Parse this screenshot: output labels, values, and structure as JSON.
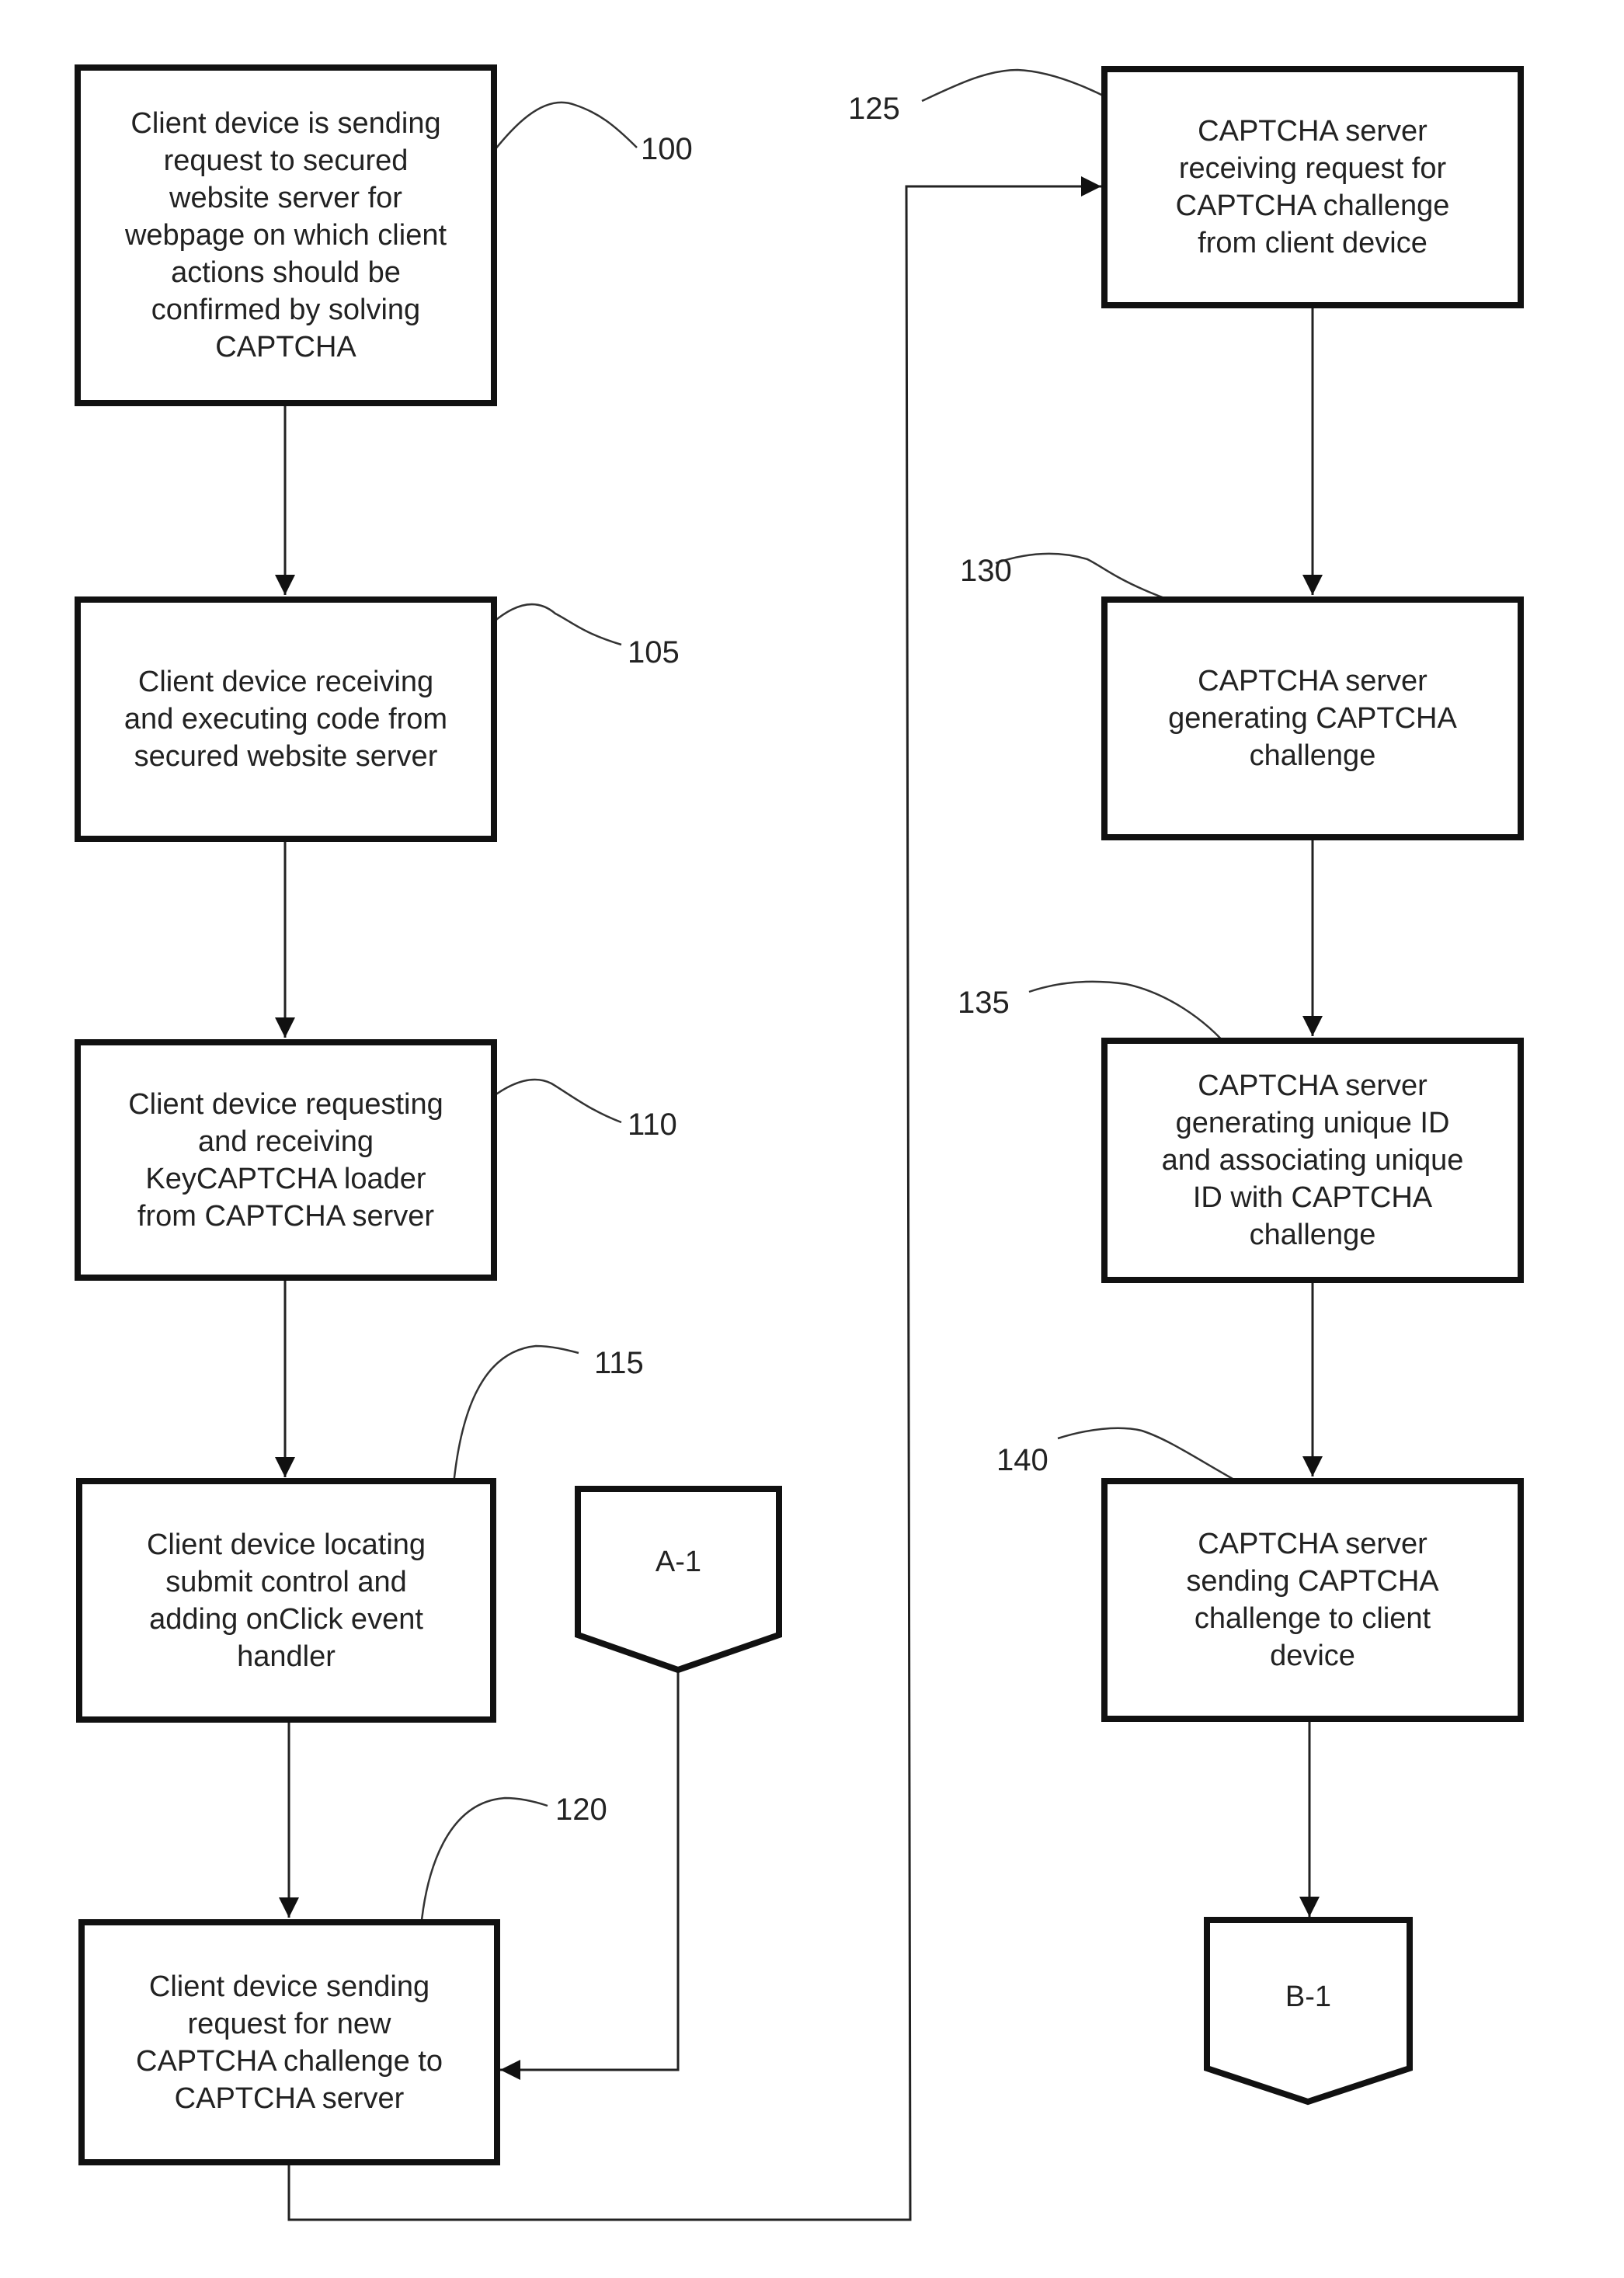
{
  "figure": {
    "type": "flowchart",
    "steps": [
      {
        "id": "100",
        "ref": "100",
        "text": "Client device is sending\nrequest to secured\nwebsite server for\nwebpage on which client\nactions should be\nconfirmed by solving\nCAPTCHA"
      },
      {
        "id": "105",
        "ref": "105",
        "text": "Client device receiving\nand executing code from\nsecured website server"
      },
      {
        "id": "110",
        "ref": "110",
        "text": "Client device requesting\nand receiving\nKeyCAPTCHA loader\nfrom CAPTCHA server"
      },
      {
        "id": "115",
        "ref": "115",
        "text": "Client device locating\nsubmit control and\nadding onClick event\nhandler"
      },
      {
        "id": "120",
        "ref": "120",
        "text": "Client device sending\nrequest for new\nCAPTCHA challenge to\nCAPTCHA server"
      },
      {
        "id": "125",
        "ref": "125",
        "text": "CAPTCHA server\nreceiving request for\nCAPTCHA challenge\nfrom client device"
      },
      {
        "id": "130",
        "ref": "130",
        "text": "CAPTCHA server\ngenerating CAPTCHA\nchallenge"
      },
      {
        "id": "135",
        "ref": "135",
        "text": "CAPTCHA server\ngenerating unique ID\nand associating unique\nID with CAPTCHA\nchallenge"
      },
      {
        "id": "140",
        "ref": "140",
        "text": "CAPTCHA server\nsending CAPTCHA\nchallenge to client\ndevice"
      }
    ],
    "connectors": [
      {
        "id": "A-1",
        "label": "A-1"
      },
      {
        "id": "B-1",
        "label": "B-1"
      }
    ],
    "edges": [
      [
        "100",
        "105"
      ],
      [
        "105",
        "110"
      ],
      [
        "110",
        "115"
      ],
      [
        "115",
        "120"
      ],
      [
        "A-1",
        "120"
      ],
      [
        "120",
        "125"
      ],
      [
        "125",
        "130"
      ],
      [
        "130",
        "135"
      ],
      [
        "135",
        "140"
      ],
      [
        "140",
        "B-1"
      ]
    ]
  }
}
